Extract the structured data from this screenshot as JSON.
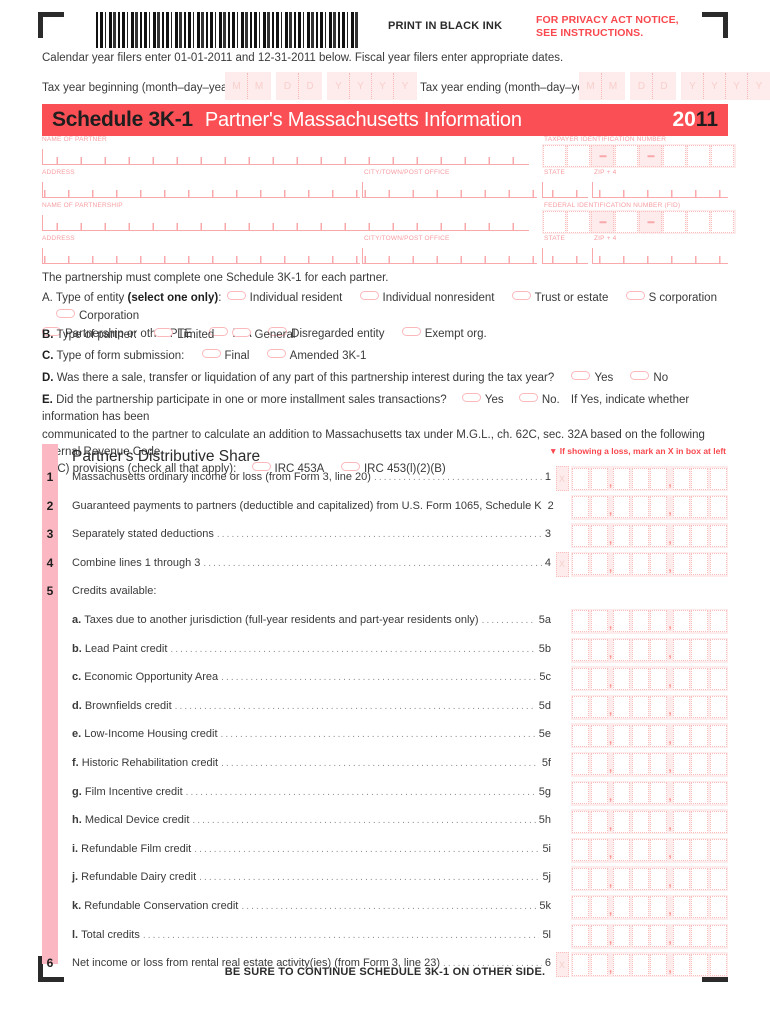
{
  "header": {
    "print_instruction": "PRINT IN BLACK INK",
    "privacy_line1": "FOR PRIVACY ACT NOTICE,",
    "privacy_line2": "SEE INSTRUCTIONS.",
    "calendar_note": "Calendar year filers enter 01-01-2011 and 12-31-2011 below. Fiscal year filers enter appropriate dates.",
    "tax_year_begin_label": "Tax year beginning (month–day–year)",
    "tax_year_end_label": "Tax year ending (month–day–year)",
    "date_placeholders": [
      "M",
      "M",
      "D",
      "D",
      "Y",
      "Y",
      "Y",
      "Y"
    ]
  },
  "banner": {
    "schedule": "Schedule 3K-1",
    "title": "Partner's Massachusetts Information",
    "year_prefix": "20",
    "year_suffix": "11",
    "color": "#fa5055"
  },
  "fields": {
    "name_of_partner": "NAME OF PARTNER",
    "taxpayer_id": "TAXPAYER IDENTIFICATION NUMBER",
    "address": "ADDRESS",
    "city_town": "CITY/TOWN/POST OFFICE",
    "state": "STATE",
    "zip": "ZIP + 4",
    "name_of_partnership": "NAME OF PARTNERSHIP",
    "federal_id": "FEDERAL IDENTIFICATION NUMBER (FID)",
    "address2": "ADDRESS",
    "city_town2": "CITY/TOWN/POST OFFICE",
    "state2": "STATE",
    "zip2": "ZIP + 4"
  },
  "statement": "The partnership must complete one Schedule 3K-1 for each partner.",
  "sections": {
    "a": {
      "letter": "A.",
      "label_pre": "Type of entity ",
      "label_bold": "(select one only)",
      "label_post": ":",
      "options_row1": [
        "Individual resident",
        "Individual nonresident",
        "Trust or estate",
        "S corporation",
        "Corporation"
      ],
      "options_row2": [
        "Partnership or other PTE",
        "IRA",
        "Disregarded entity",
        "Exempt org."
      ]
    },
    "b": {
      "letter": "B.",
      "label": "Type of partner:",
      "options": [
        "Limited",
        "General"
      ]
    },
    "c": {
      "letter": "C.",
      "label": "Type of form submission:",
      "options": [
        "Final",
        "Amended 3K-1"
      ]
    },
    "d": {
      "letter": "D.",
      "label": "Was there a sale, transfer or liquidation of any part of this partnership interest during the tax year?",
      "options": [
        "Yes",
        "No"
      ]
    },
    "e": {
      "letter": "E.",
      "label": "Did the partnership participate in one or more installment sales transactions?",
      "options": [
        "Yes",
        "No."
      ],
      "continuation1": "If Yes, indicate whether information has been",
      "continuation2": "communicated to the partner to calculate an addition to Massachusetts tax under M.G.L., ch. 62C, sec. 32A based on the following Internal Revenue Code",
      "continuation3": "(IRC) provisions (check all that apply):",
      "irc_options": [
        "IRC 453A",
        "IRC 453(l)(2)(B)"
      ]
    }
  },
  "distributive": {
    "title": "Partner's Distributive Share",
    "loss_note": "▼ If showing a loss, mark an X in box at left",
    "lines": [
      {
        "num": "1",
        "text": "Massachusetts ordinary income or loss (from Form 3, line 20)",
        "ref": "1",
        "xbox": true
      },
      {
        "num": "2",
        "text": "Guaranteed payments to partners (deductible and capitalized) from U.S. Form 1065, Schedule K",
        "ref": "2",
        "xbox": false
      },
      {
        "num": "3",
        "text": "Separately stated deductions",
        "ref": "3",
        "xbox": false
      },
      {
        "num": "4",
        "text": "Combine lines 1 through 3",
        "ref": "4",
        "xbox": true
      },
      {
        "num": "5",
        "text": "Credits available:",
        "ref": "",
        "xbox": false,
        "heading": true
      },
      {
        "num": "",
        "sub": "a.",
        "text": "Taxes due to another jurisdiction (full-year residents and part-year residents only)",
        "ref": "5a",
        "xbox": false
      },
      {
        "num": "",
        "sub": "b.",
        "text": "Lead Paint credit",
        "ref": "5b",
        "xbox": false
      },
      {
        "num": "",
        "sub": "c.",
        "text": "Economic Opportunity Area",
        "ref": "5c",
        "xbox": false
      },
      {
        "num": "",
        "sub": "d.",
        "text": "Brownfields credit",
        "ref": "5d",
        "xbox": false
      },
      {
        "num": "",
        "sub": "e.",
        "text": "Low-Income Housing credit",
        "ref": "5e",
        "xbox": false
      },
      {
        "num": "",
        "sub": "f.",
        "text": "Historic Rehabilitation credit",
        "ref": "5f",
        "xbox": false
      },
      {
        "num": "",
        "sub": "g.",
        "text": "Film Incentive credit",
        "ref": "5g",
        "xbox": false
      },
      {
        "num": "",
        "sub": "h.",
        "text": "Medical Device credit",
        "ref": "5h",
        "xbox": false
      },
      {
        "num": "",
        "sub": "i.",
        "text": "Refundable Film credit",
        "ref": "5i",
        "xbox": false
      },
      {
        "num": "",
        "sub": "j.",
        "text": "Refundable Dairy credit",
        "ref": "5j",
        "xbox": false
      },
      {
        "num": "",
        "sub": "k.",
        "text": "Refundable Conservation credit",
        "ref": "5k",
        "xbox": false
      },
      {
        "num": "",
        "sub": "l.",
        "text": "Total credits",
        "ref": "5l",
        "xbox": false
      },
      {
        "num": "6",
        "text": "Net income or loss from rental real estate activity(ies) (from Form 3, line 23)",
        "ref": "6",
        "xbox": true
      }
    ]
  },
  "footer": "BE SURE TO CONTINUE SCHEDULE 3K-1 ON OTHER SIDE."
}
